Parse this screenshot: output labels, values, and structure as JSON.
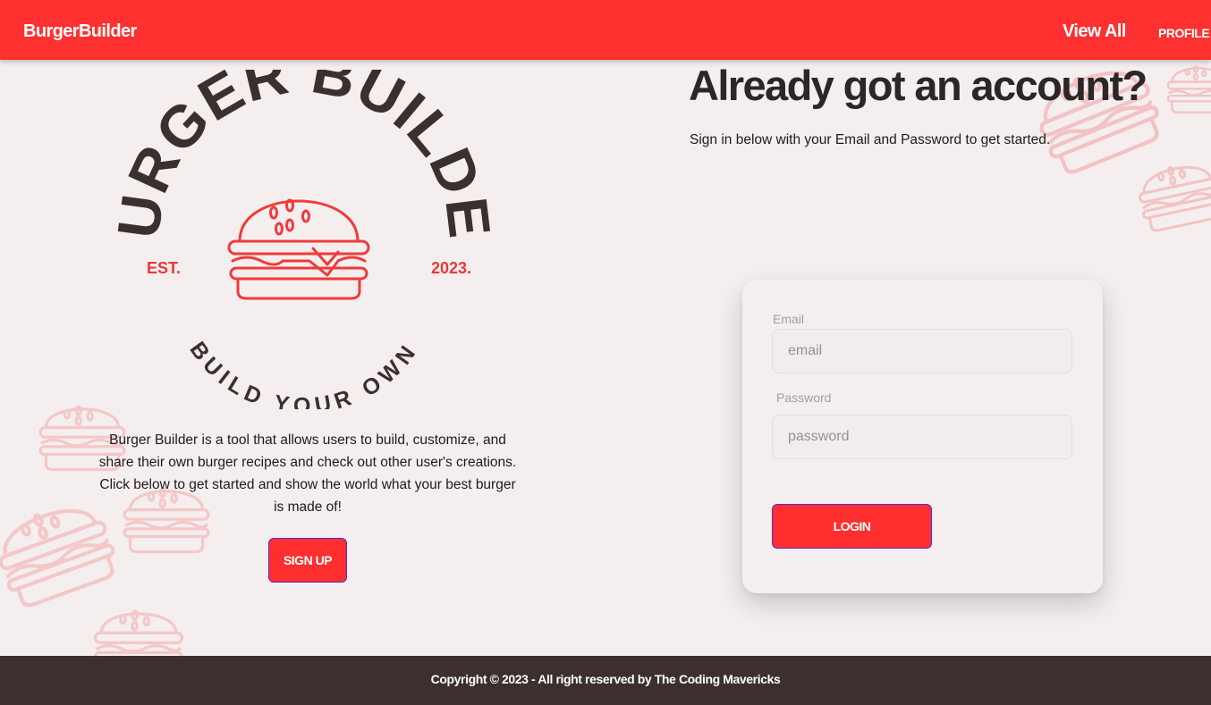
{
  "navbar": {
    "brand": "BurgerBuilder",
    "view_all": "View All",
    "profile": "PROFILE"
  },
  "logo": {
    "arc_text": "BURGER BUILDER",
    "est": "EST.",
    "year": "2023.",
    "tagline": "BUILD YOUR OWN"
  },
  "left": {
    "description": "Burger Builder is a tool that allows users to build, customize, and share their own burger recipes and check out other user's creations. Click below to get started and show the world what your best burger is made of!",
    "signup_label": "SIGN UP"
  },
  "right": {
    "heading": "Already got an account?",
    "subheading": "Sign in below with your Email and Password to get started."
  },
  "login_form": {
    "email_label": "Email",
    "email_placeholder": "email",
    "email_value": "",
    "password_label": "Password",
    "password_placeholder": "password",
    "password_value": "",
    "login_label": "LOGIN"
  },
  "footer": {
    "copyright": "Copyright © 2023 - All right reserved by The Coding Mavericks"
  },
  "colors": {
    "brand_red": "#ff3030",
    "background": "#f5eeee",
    "dark_brown": "#3b302e",
    "text_dark": "#2c2626",
    "button_border": "#5a2ad6",
    "decor_pink": "#f4c4c4"
  },
  "icons": [
    "burger-icon",
    "burger-pattern-icon"
  ]
}
